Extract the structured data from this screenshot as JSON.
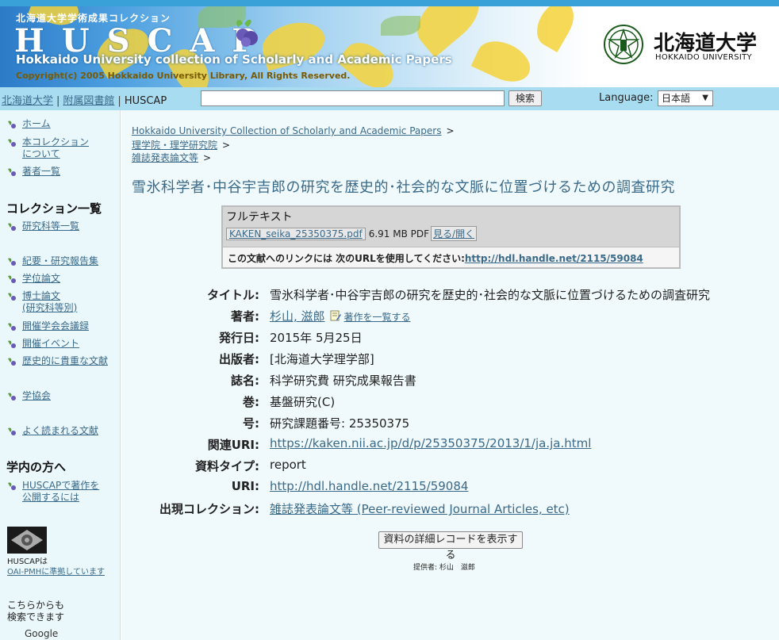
{
  "header": {
    "site_subtitle": "北海道大学学術成果コレクション",
    "site_logo": "HUSCAP",
    "site_tagline": "Hokkaido University collection of Scholarly and Academic Papers",
    "copyright": "Copyright(c) 2005 Hokkaido University Library, All Rights Reserved.",
    "univ_name": "北海道大学",
    "univ_name_en": "HOKKAIDO UNIVERSITY"
  },
  "navbar": {
    "links": [
      "北海道大学",
      "附属図書館"
    ],
    "current": "HUSCAP",
    "search_value": "",
    "search_button": "検索",
    "language_label": "Language:",
    "language_selected": "日本語"
  },
  "sidebar": {
    "items_top": [
      "ホーム",
      "本コレクション\nについて",
      "著者一覧"
    ],
    "collections_heading": "コレクション一覧",
    "collections": [
      "研究科等一覧",
      "紀要・研究報告集",
      "学位論文",
      "博士論文\n(研究科等別)",
      "開催学会会議録",
      "開催イベント",
      "歴史的に貴重な文献",
      "学協会",
      "よく読まれる文献"
    ],
    "campus_heading": "学内の方へ",
    "campus_items": [
      "HUSCAPで著作を\n公開するには"
    ],
    "oai_text1": "HUSCAPは",
    "oai_link": "OAI-PMH",
    "oai_text2": "に準拠しています",
    "search_from_line1": "こちらからも",
    "search_from_line2": "検索できます",
    "google_label": "Google"
  },
  "breadcrumb": [
    "Hokkaido University Collection of Scholarly and Academic Papers",
    "理学院・理学研究院",
    "雑誌発表論文等"
  ],
  "breadcrumb_sep": ">",
  "page_title": "雪氷科学者･中谷宇吉郎の研究を歴史的･社会的な文脈に位置づけるための調査研究",
  "fulltext": {
    "heading": "フルテキスト",
    "file_name": "KAKEN_seika_25350375.pdf",
    "file_size": "6.91 MB PDF",
    "open_label": "見る/開く",
    "link_prefix": "この文献へのリンクには 次のURLを使用してください:",
    "link_url": "http://hdl.handle.net/2115/59084"
  },
  "metadata": {
    "title_label": "タイトル:",
    "title_value": "雪氷科学者･中谷宇吉郎の研究を歴史的･社会的な文脈に位置づけるための調査研究",
    "author_label": "著者:",
    "author_value": "杉山, 滋郎",
    "author_list_link": "著作を一覧する",
    "date_label": "発行日:",
    "date_value": "2015年 5月25日",
    "publisher_label": "出版者:",
    "publisher_value": "[北海道大学理学部]",
    "journal_label": "誌名:",
    "journal_value": "科学研究費 研究成果報告書",
    "volume_label": "巻:",
    "volume_value": "基盤研究(C)",
    "number_label": "号:",
    "number_value": "研究課題番号: 25350375",
    "related_uri_label": "関連URI:",
    "related_uri_value": "https://kaken.nii.ac.jp/d/p/25350375/2013/1/ja.ja.html",
    "type_label": "資料タイプ:",
    "type_value": "report",
    "uri_label": "URI:",
    "uri_value": "http://hdl.handle.net/2115/59084",
    "collection_label": "出現コレクション:",
    "collection_value": "雑誌発表論文等 (Peer-reviewed Journal Articles, etc)"
  },
  "detail_button": "資料の詳細レコードを表示する",
  "provider": "提供者: 杉山　滋郎",
  "colors": {
    "link": "#3a6a8a",
    "navbar": "#a8dcf0",
    "sidebar_bg": "#eaf7fb",
    "main_bg": "#f0f9fb"
  }
}
